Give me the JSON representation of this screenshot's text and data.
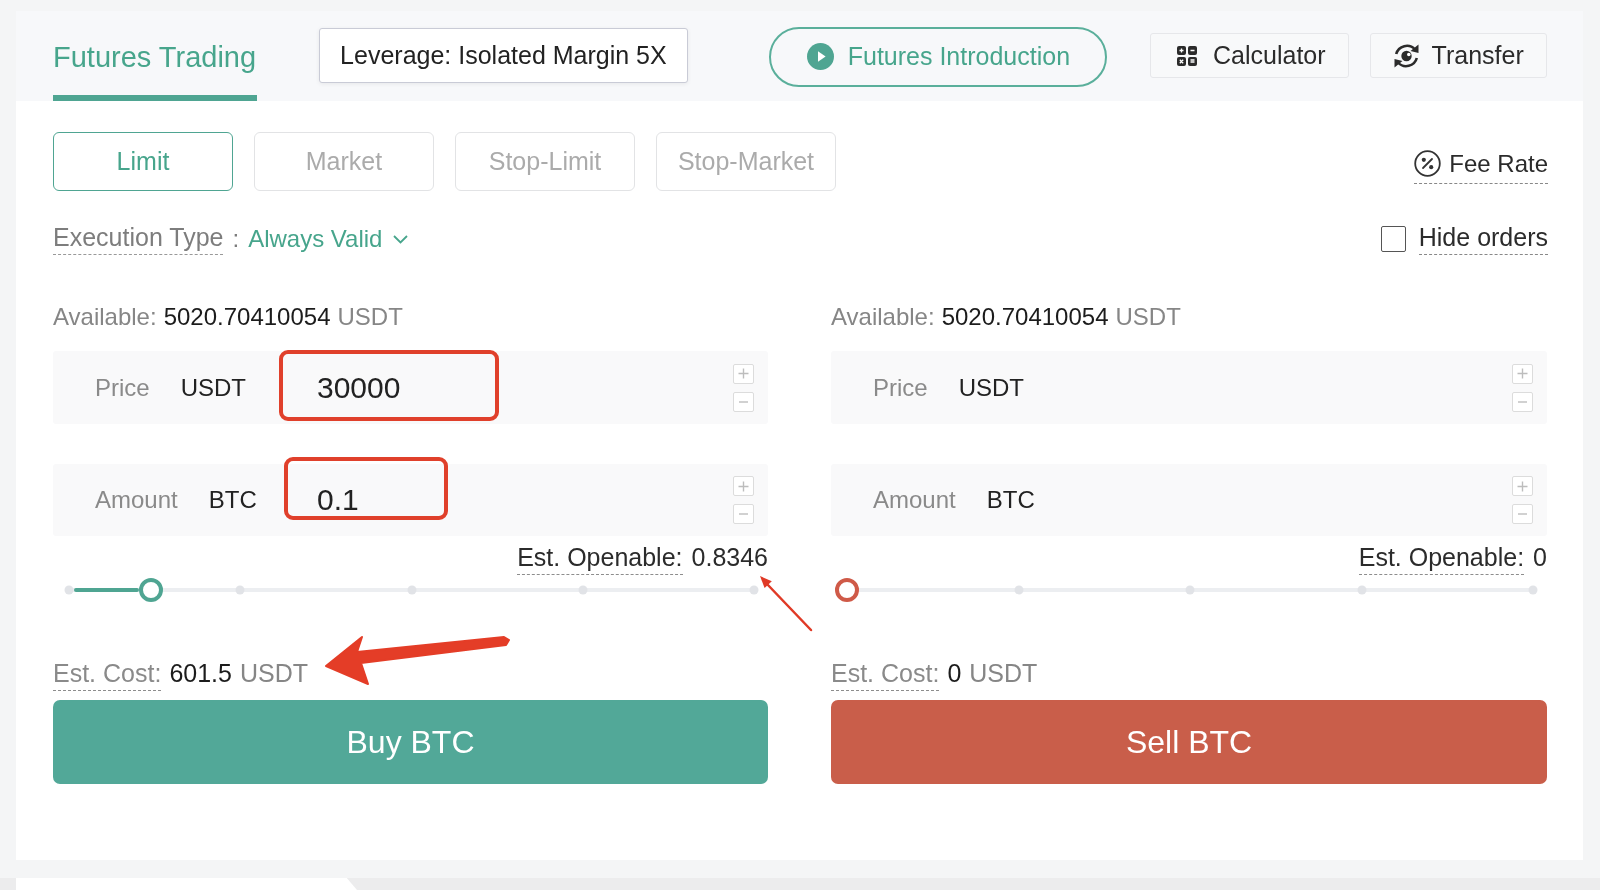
{
  "header": {
    "tabs": [
      {
        "label": "Futures Trading",
        "selected": true
      }
    ],
    "leverage": "Leverage: Isolated Margin 5X",
    "introduction": "Futures Introduction",
    "tools": [
      {
        "kind": "calculator",
        "label": "Calculator"
      },
      {
        "kind": "transfer",
        "label": "Transfer"
      }
    ]
  },
  "order_types": [
    {
      "label": "Limit",
      "selected": true
    },
    {
      "label": "Market",
      "selected": false
    },
    {
      "label": "Stop-Limit",
      "selected": false
    },
    {
      "label": "Stop-Market",
      "selected": false
    }
  ],
  "fee_rate": "Fee Rate",
  "execution_type": {
    "label": "Execution Type",
    "separator": ":",
    "value": "Always Valid"
  },
  "hide_orders": {
    "label": "Hide orders",
    "checked": false
  },
  "forms": [
    {
      "kind": "buy",
      "available": {
        "label": "Available:",
        "value": "5020.70410054",
        "unit": "USDT"
      },
      "fields": [
        {
          "label": "Price",
          "unit": "USDT",
          "value": "30000",
          "highlighted": true
        },
        {
          "label": "Amount",
          "unit": "BTC",
          "value": "0.1",
          "highlighted": true
        }
      ],
      "openable": {
        "label": "Est. Openable:",
        "value": "0.8346",
        "arrow": true
      },
      "level": 0.12,
      "cost": {
        "label": "Est. Cost:",
        "value": "601.5",
        "unit": "USDT",
        "arrow": true
      },
      "action": "Buy BTC"
    },
    {
      "kind": "sell",
      "available": {
        "label": "Available:",
        "value": "5020.70410054",
        "unit": "USDT"
      },
      "fields": [
        {
          "label": "Price",
          "unit": "USDT",
          "highlighted": false
        },
        {
          "label": "Amount",
          "unit": "BTC",
          "highlighted": false
        }
      ],
      "openable": {
        "label": "Est. Openable:",
        "value": "0",
        "arrow": false
      },
      "level": 0,
      "cost": {
        "label": "Est. Cost:",
        "value": "0",
        "unit": "USDT",
        "arrow": false
      },
      "action": "Sell BTC"
    }
  ]
}
